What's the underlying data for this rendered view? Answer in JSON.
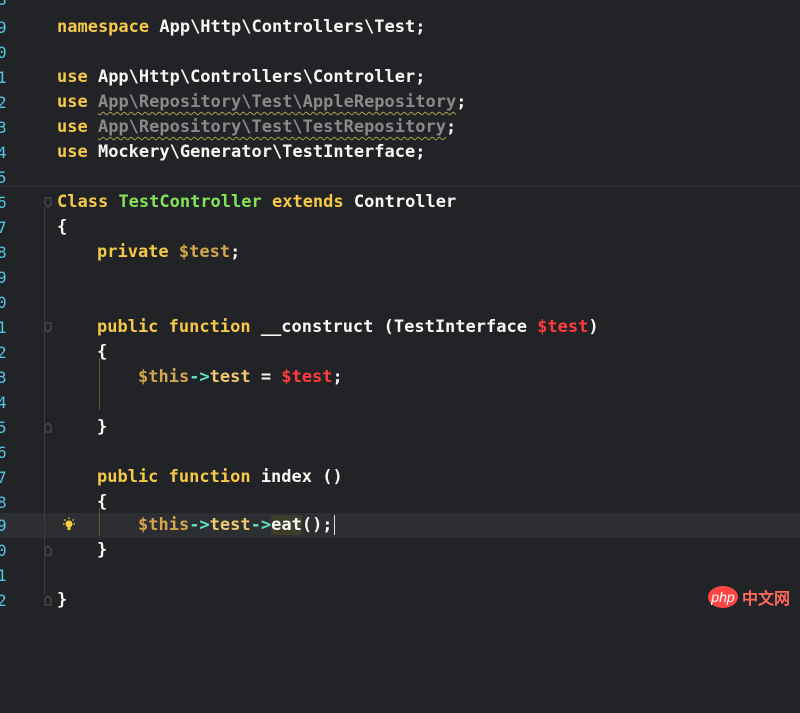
{
  "line_numbers": [
    "9",
    "0",
    "",
    "1",
    "2",
    "3",
    "4",
    "5",
    "6",
    "7",
    "8",
    "9",
    "0",
    "1",
    "2",
    "3",
    "4",
    "5",
    "6",
    "7",
    "8",
    "9",
    "0",
    "1",
    "2"
  ],
  "first_number": "8",
  "code": {
    "l9": {
      "kw": "namespace",
      "rest": " App\\Http\\Controllers\\Test;"
    },
    "l11": {
      "kw": "use",
      "rest": " App\\Http\\Controllers\\Controller;"
    },
    "l12": {
      "kw": "use",
      "ns": "App\\Repository\\Test\\AppleRepository",
      "end": ";"
    },
    "l13": {
      "kw": "use",
      "ns": "App\\Repository\\Test\\TestRepository",
      "end": ";"
    },
    "l14": {
      "kw": "use",
      "rest": " Mockery\\Generator\\TestInterface;"
    },
    "l16": {
      "kw1": "Class",
      "cls": "TestController",
      "kw2": "extends",
      "parent": "Controller"
    },
    "l17": {
      "text": "{"
    },
    "l18": {
      "kw": "private",
      "var": "$test",
      "end": ";"
    },
    "l21": {
      "kw1": "public",
      "kw2": "function",
      "name": "__construct",
      "open": " (TestInterface ",
      "var": "$test",
      "close": ")"
    },
    "l22": {
      "text": "{"
    },
    "l23": {
      "this": "$this",
      "arrow": "->",
      "prop": "test",
      "eq": " = ",
      "var": "$test",
      "end": ";"
    },
    "l25": {
      "text": "}"
    },
    "l27": {
      "kw1": "public",
      "kw2": "function",
      "name": "index",
      "parens": " ()"
    },
    "l28": {
      "text": "{"
    },
    "l29": {
      "this": "$this",
      "arrow1": "->",
      "prop": "test",
      "arrow2": "->",
      "method": "eat",
      "end": "();"
    },
    "l30": {
      "text": "}"
    },
    "l32": {
      "text": "}"
    }
  },
  "watermark": {
    "logo": "php",
    "text": "中文网"
  },
  "colors": {
    "background": "#222326",
    "keyword": "#f7c948",
    "class": "#84e35a",
    "variable_red": "#ff3b3b",
    "line_number": "#4ec8e6"
  }
}
